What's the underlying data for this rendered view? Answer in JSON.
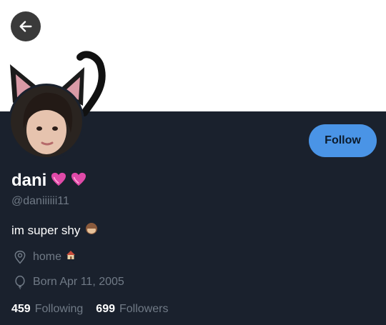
{
  "header": {
    "back_icon": "arrow-left-icon"
  },
  "profile": {
    "display_name": "dani",
    "name_emojis": [
      "heart-icon",
      "heart-icon"
    ],
    "handle": "@daniiiiii11",
    "bio_text": "im super shy",
    "bio_emoji": "see-no-evil-monkey-icon",
    "location": "home",
    "location_emoji": "house-icon",
    "born": "Born Apr 11, 2005",
    "avatar_decoration": "cat-ears-and-tail"
  },
  "actions": {
    "follow_label": "Follow"
  },
  "stats": {
    "following_count": "459",
    "following_label": "Following",
    "followers_count": "699",
    "followers_label": "Followers"
  },
  "colors": {
    "panel_bg": "#1a212d",
    "accent": "#4a94e6",
    "muted_text": "#707a86",
    "heart": "#e04aa8"
  }
}
